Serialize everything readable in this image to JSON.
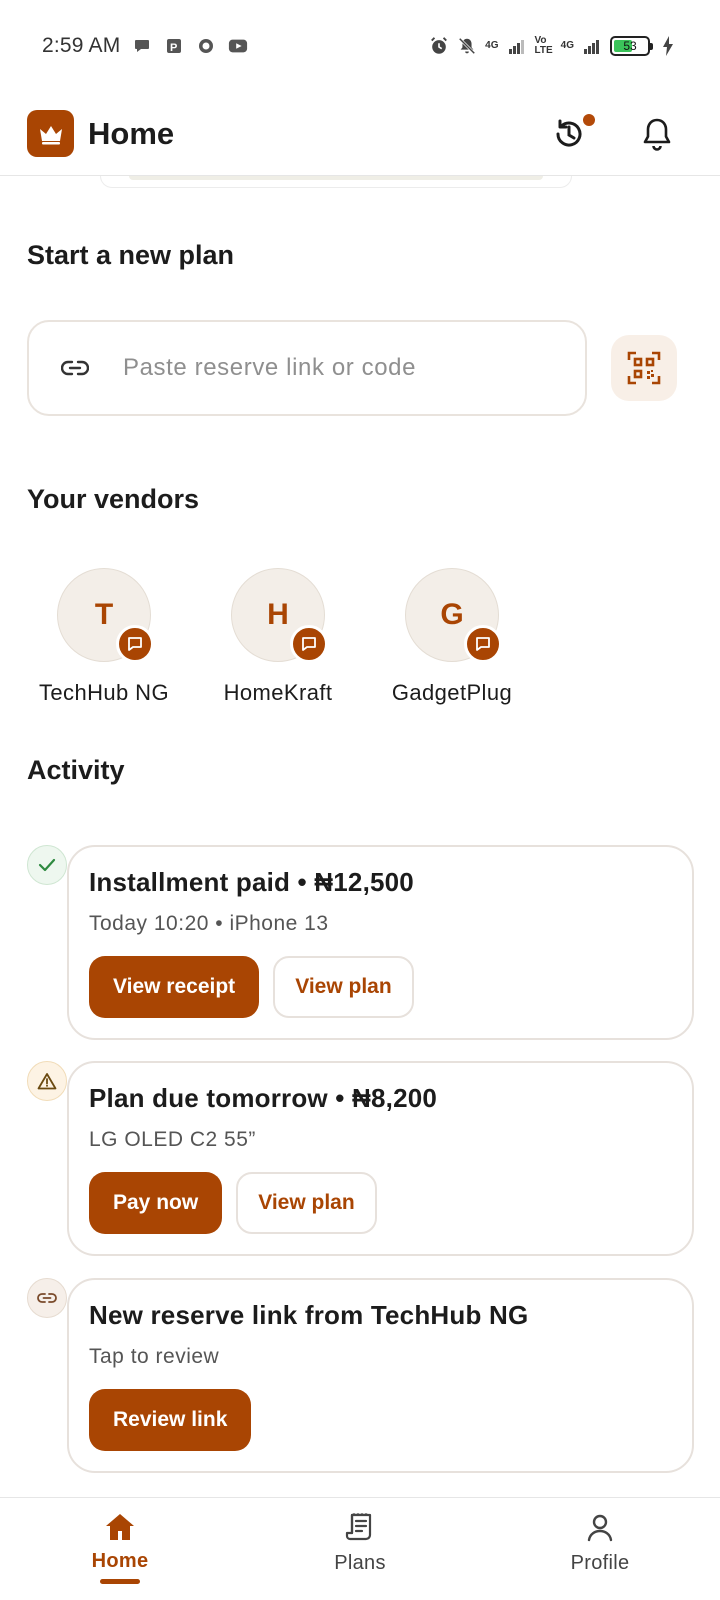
{
  "status_bar": {
    "time": "2:59 AM",
    "network_1": "4G",
    "network_2": "Vo\nLTE",
    "network_3": "4G",
    "battery": "53"
  },
  "header": {
    "title": "Home",
    "logo_icon": "crown-icon",
    "history_icon": "history-icon",
    "bell_icon": "bell-icon",
    "accent": "#a94503"
  },
  "new_plan": {
    "title": "Start a new plan",
    "input_value": "",
    "input_placeholder": "Paste reserve link or code"
  },
  "vendors": {
    "title": "Your vendors",
    "items": [
      {
        "initial": "T",
        "name": "TechHub NG"
      },
      {
        "initial": "H",
        "name": "HomeKraft"
      },
      {
        "initial": "G",
        "name": "GadgetPlug"
      }
    ]
  },
  "activity": {
    "title": "Activity",
    "items": [
      {
        "status": "success",
        "title": "Installment paid • ₦12,500",
        "subtitle": "Today 10:20 • iPhone 13",
        "primary": "View receipt",
        "secondary": "View plan"
      },
      {
        "status": "warning",
        "title": "Plan due tomorrow • ₦8,200",
        "subtitle": "LG OLED C2 55”",
        "primary": "Pay now",
        "secondary": "View plan"
      },
      {
        "status": "link",
        "title": "New reserve link from TechHub NG",
        "subtitle": "Tap to review",
        "primary": "Review link"
      }
    ]
  },
  "bottom_nav": {
    "items": [
      {
        "label": "Home",
        "active": true
      },
      {
        "label": "Plans",
        "active": false
      },
      {
        "label": "Profile",
        "active": false
      }
    ]
  }
}
